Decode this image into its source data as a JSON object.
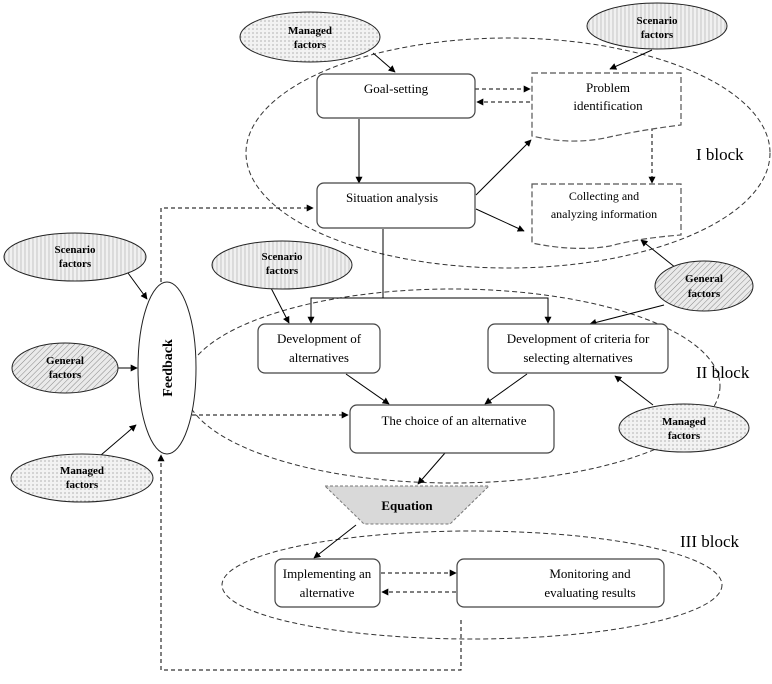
{
  "nodes": {
    "goal_setting": "Goal-setting",
    "problem_identification": [
      "Problem",
      "identification"
    ],
    "situation_analysis": "Situation analysis",
    "collecting_info": [
      "Collecting and",
      "analyzing information"
    ],
    "dev_alternatives": [
      "Development of",
      "alternatives"
    ],
    "dev_criteria": [
      "Development of criteria for",
      "selecting alternatives"
    ],
    "choice": "The choice of an alternative",
    "equation": "Equation",
    "implementing": [
      "Implementing an",
      "alternative"
    ],
    "monitoring": [
      "Monitoring and",
      "evaluating results"
    ],
    "feedback": "Feedback"
  },
  "factors": {
    "managed": [
      "Managed",
      "factors"
    ],
    "scenario": [
      "Scenario",
      "factors"
    ],
    "general": [
      "General",
      "factors"
    ]
  },
  "blocks": {
    "block1": "I block",
    "block2": "II block",
    "block3": "III block"
  },
  "colors": {
    "equation_fill": "#d9d9d9",
    "factor_fill": "#e8e8e8"
  }
}
